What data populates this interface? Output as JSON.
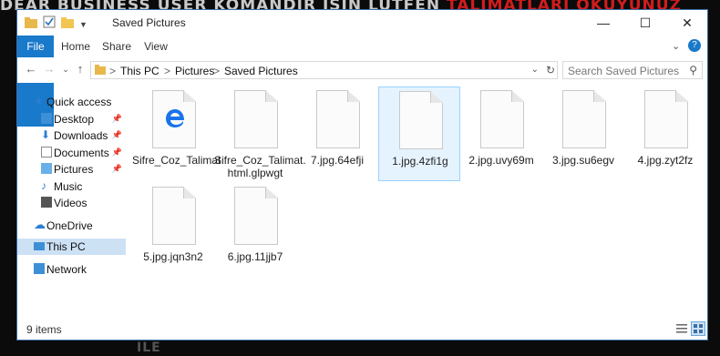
{
  "window": {
    "title": "Saved Pictures"
  },
  "ribbon": {
    "tabs": [
      "File",
      "Home",
      "Share",
      "View"
    ]
  },
  "address": {
    "crumbs": [
      "This PC",
      "Pictures",
      "Saved Pictures"
    ],
    "separator": ">",
    "search_placeholder": "Search Saved Pictures"
  },
  "nav": {
    "quick_access": "Quick access",
    "items": [
      "Desktop",
      "Downloads",
      "Documents",
      "Pictures",
      "Music",
      "Videos"
    ],
    "onedrive": "OneDrive",
    "this_pc": "This PC",
    "network": "Network"
  },
  "files": [
    {
      "name": "Sifre_Coz_Talimat",
      "icon": "edge-icon"
    },
    {
      "name": "Sifre_Coz_Talimat.\nhtml.glpwgt"
    },
    {
      "name": "7.jpg.64efji"
    },
    {
      "name": "1.jpg.4zfi1g"
    },
    {
      "name": "2.jpg.uvy69m"
    },
    {
      "name": "3.jpg.su6egv"
    },
    {
      "name": "4.jpg.zyt2fz"
    },
    {
      "name": "5.jpg.jqn3n2"
    },
    {
      "name": "6.jpg.11jjb7"
    }
  ],
  "status": {
    "items": "9 items"
  },
  "background_text": {
    "line1": "DEAR BUSINESS USER KOMANDIR ISIN LUTFEN",
    "line1_red": "TALIMATLARI OKUYUNUZ",
    "line2": "ILE"
  },
  "colors": {
    "accent": "#1979ca",
    "selection": "#cde1f5",
    "red": "#d21c1c"
  }
}
